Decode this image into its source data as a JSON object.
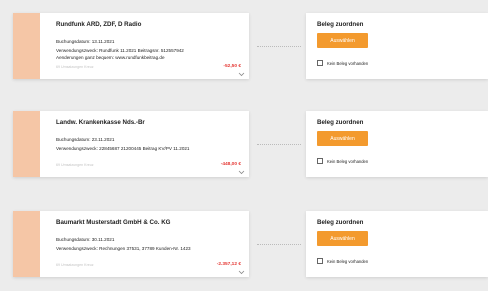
{
  "transactions": [
    {
      "payee": "Rundfunk ARD, ZDF, D Radio",
      "booking_date": "Buchungsdatum: 13.11.2021",
      "purpose": "Verwendungszweck: Rundfunk 11.2021 Beitragsnr. 512557942",
      "purpose2": "Aenderungen ganz bequem: www.rundfunkbeitrag.de",
      "more": "69 Umsatzungen Kreuz",
      "amount": "-52,50 €",
      "receipt": {
        "title": "Beleg zuordnen",
        "button": "Auswählen",
        "no_receipt": "Kein Beleg vorhanden"
      }
    },
    {
      "payee": "Landw. Krankenkasse Nds.-Br",
      "booking_date": "Buchungsdatum: 23.11.2021",
      "purpose": "Verwendungszweck: 22845687 21200445 Beitrag KV/PV 11.2021",
      "purpose2": "",
      "more": "69 Umsatzungen Kreuz",
      "amount": "-448,00 €",
      "receipt": {
        "title": "Beleg zuordnen",
        "button": "Auswählen",
        "no_receipt": "Kein Beleg vorhanden"
      }
    },
    {
      "payee": "Baumarkt Musterstadt GmbH & Co. KG",
      "booking_date": "Buchungsdatum: 30.11.2021",
      "purpose": "Verwendungszweck: Rechnungen 37531, 37789 Kunden-Nr. 1423",
      "purpose2": "",
      "more": "69 Umsatzungen Kreuz",
      "amount": "-2.357,12 €",
      "receipt": {
        "title": "Beleg zuordnen",
        "button": "Auswählen",
        "no_receipt": "Kein Beleg vorhanden"
      }
    }
  ],
  "colors": {
    "accent": "#f39a2e",
    "stripe": "#f5c6a6",
    "amount": "#e53935"
  }
}
